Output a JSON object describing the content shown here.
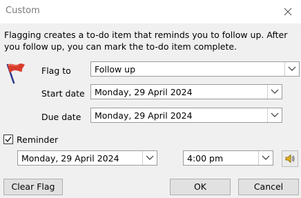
{
  "window": {
    "title": "Custom"
  },
  "description": "Flagging creates a to-do item that reminds you to follow up. After you follow up, you can mark the to-do item complete.",
  "flag_to": {
    "label": "Flag to",
    "value": "Follow up"
  },
  "start_date": {
    "label": "Start date",
    "value": "Monday, 29 April 2024"
  },
  "due_date": {
    "label": "Due date",
    "value": "Monday, 29 April 2024"
  },
  "reminder": {
    "label": "Reminder",
    "checked": true,
    "date": "Monday, 29 April 2024",
    "time": "4:00 pm"
  },
  "buttons": {
    "clear_flag": "Clear Flag",
    "ok": "OK",
    "cancel": "Cancel"
  },
  "icons": {
    "flag": "red-flag-icon",
    "close": "close-icon",
    "dropdown": "chevron-down-icon",
    "sound": "speaker-icon",
    "check": "checkmark-icon"
  },
  "colors": {
    "flag_red": "#d93b2b",
    "flag_pole": "#2b3a8c"
  }
}
